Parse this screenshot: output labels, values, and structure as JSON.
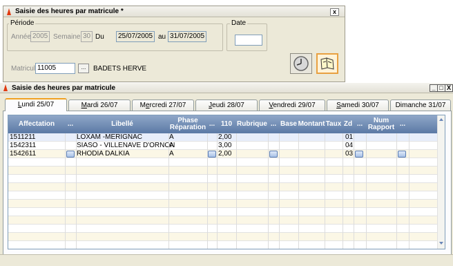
{
  "top_window": {
    "title": "Saisie des heures par matricule *",
    "close": "x",
    "periode": {
      "legend": "Période",
      "annee_label": "Année",
      "annee_value": "2005",
      "semaine_label": "Semaine",
      "semaine_value": "30",
      "du_label": "Du",
      "du_value": "25/07/2005",
      "au_label": "au",
      "au_value": "31/07/2005"
    },
    "date": {
      "legend": "Date",
      "value": ""
    },
    "matricule": {
      "label": "Matricule",
      "value": "11005",
      "browse": "...",
      "name": "BADETS HERVE"
    }
  },
  "grid_window": {
    "title": "Saisie des heures par matricule",
    "controls": [
      "_",
      "□",
      "X"
    ],
    "tabs": [
      {
        "pre": "",
        "u": "L",
        "post": "undi 25/07"
      },
      {
        "pre": "",
        "u": "M",
        "post": "ardi 26/07"
      },
      {
        "pre": "M",
        "u": "e",
        "post": "rcredi 27/07"
      },
      {
        "pre": "",
        "u": "J",
        "post": "eudi 28/07"
      },
      {
        "pre": "",
        "u": "V",
        "post": "endredi 29/07"
      },
      {
        "pre": "",
        "u": "S",
        "post": "amedi 30/07"
      },
      {
        "pre": "Dimanche 31/07",
        "u": "",
        "post": ""
      }
    ],
    "columns": {
      "affectation": "Affectation",
      "dots1": "...",
      "libelle": "Libellé",
      "phase": "Phase Réparation",
      "dots2": "...",
      "c110": "110",
      "rubrique": "Rubrique",
      "dots3": "...",
      "base": "Base",
      "montant": "Montant",
      "taux": "Taux",
      "zd": "Zd",
      "dots4": "...",
      "num_rapport": "Num Rapport",
      "dots5": "..."
    },
    "rows": [
      {
        "affectation": "1511211",
        "libelle": "LOXAM -MERIGNAC",
        "phase": "A",
        "c110": "2,00",
        "zd": "01"
      },
      {
        "affectation": "1542311",
        "libelle": "SIASO - VILLENAVE D'ORNON",
        "phase": "A",
        "c110": "3,00",
        "zd": "04"
      },
      {
        "affectation": "1542611",
        "libelle": "RHODIA DALKIA",
        "phase": "A",
        "c110": "2,00",
        "zd": "03"
      }
    ],
    "colors": {
      "header_top": "#8fa7c8",
      "header_bottom": "#5b79a5",
      "selected_row": "#e8eefb",
      "alt_row": "#fbf7e6"
    }
  }
}
